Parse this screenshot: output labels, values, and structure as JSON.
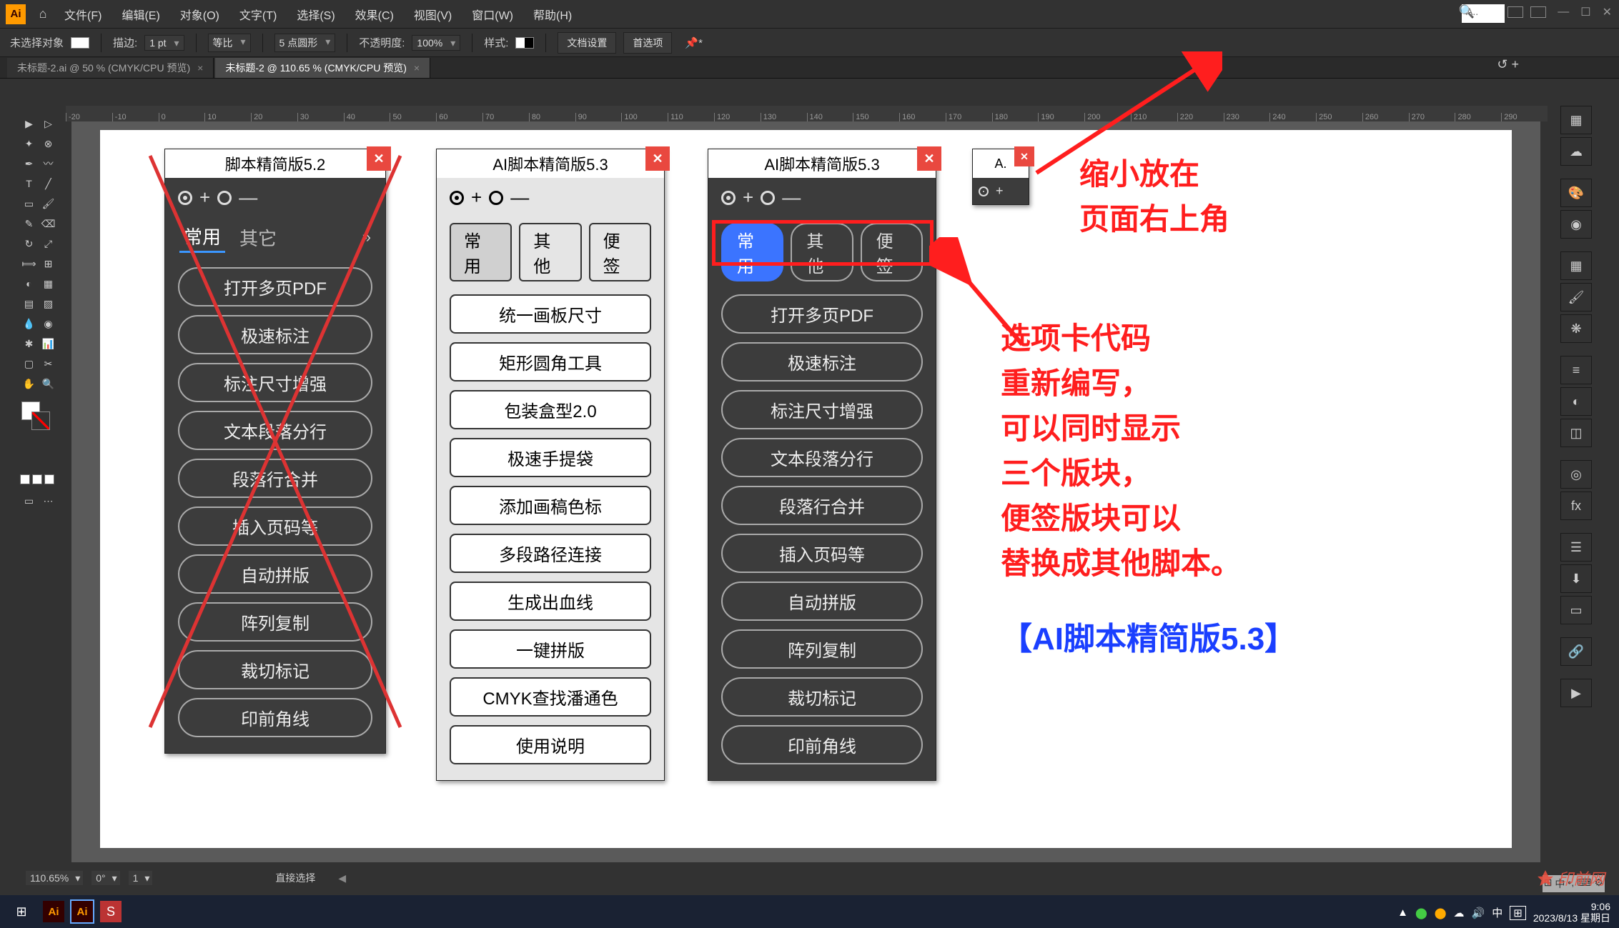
{
  "menubar": {
    "items": [
      "文件(F)",
      "编辑(E)",
      "对象(O)",
      "文字(T)",
      "选择(S)",
      "效果(C)",
      "视图(V)",
      "窗口(W)",
      "帮助(H)"
    ],
    "title_box": "A.."
  },
  "optbar": {
    "no_selection": "未选择对象",
    "stroke_label": "描边:",
    "stroke_val": "1 pt",
    "uniform": "等比",
    "brush": "5 点圆形",
    "opacity_label": "不透明度:",
    "opacity_val": "100%",
    "style_label": "样式:",
    "doc_setup": "文档设置",
    "prefs": "首选项"
  },
  "tabs": [
    {
      "label": "未标题-2.ai @ 50 % (CMYK/CPU 预览)",
      "active": false
    },
    {
      "label": "未标题-2 @ 110.65 % (CMYK/CPU 预览)",
      "active": true
    }
  ],
  "ruler_marks": [
    "-20",
    "-10",
    "0",
    "10",
    "20",
    "30",
    "40",
    "50",
    "60",
    "70",
    "80",
    "90",
    "100",
    "110",
    "120",
    "130",
    "140",
    "150",
    "160",
    "170",
    "180",
    "190",
    "200",
    "210",
    "220",
    "230",
    "240",
    "250",
    "260",
    "270",
    "280",
    "290"
  ],
  "panel1": {
    "title": "脚本精简版5.2",
    "tabs": [
      "常用",
      "其它"
    ],
    "buttons": [
      "打开多页PDF",
      "极速标注",
      "标注尺寸增强",
      "文本段落分行",
      "段落行合并",
      "插入页码等",
      "自动拼版",
      "阵列复制",
      "裁切标记",
      "印前角线"
    ]
  },
  "panel2": {
    "title": "AI脚本精简版5.3",
    "tabs": [
      "常用",
      "其他",
      "便签"
    ],
    "buttons": [
      "统一画板尺寸",
      "矩形圆角工具",
      "包装盒型2.0",
      "极速手提袋",
      "添加画稿色标",
      "多段路径连接",
      "生成出血线",
      "一键拼版",
      "CMYK查找潘通色",
      "使用说明"
    ]
  },
  "panel3": {
    "title": "AI脚本精简版5.3",
    "tabs": [
      "常用",
      "其他",
      "便签"
    ],
    "buttons": [
      "打开多页PDF",
      "极速标注",
      "标注尺寸增强",
      "文本段落分行",
      "段落行合并",
      "插入页码等",
      "自动拼版",
      "阵列复制",
      "裁切标记",
      "印前角线"
    ]
  },
  "panel_mini": {
    "title": "A."
  },
  "annotations": {
    "top": "缩小放在\n页面右上角",
    "mid": "选项卡代码\n重新编写，\n可以同时显示\n三个版块，\n便签版块可以\n替换成其他脚本。",
    "bottom": "【AI脚本精简版5.3】"
  },
  "statusbar": {
    "zoom": "110.65%",
    "angle": "0°",
    "artboard": "1",
    "tool": "直接选择"
  },
  "taskbar": {
    "clock_time": "9:06",
    "clock_date": "2023/8/13 星期日"
  },
  "watermark": "印前网"
}
